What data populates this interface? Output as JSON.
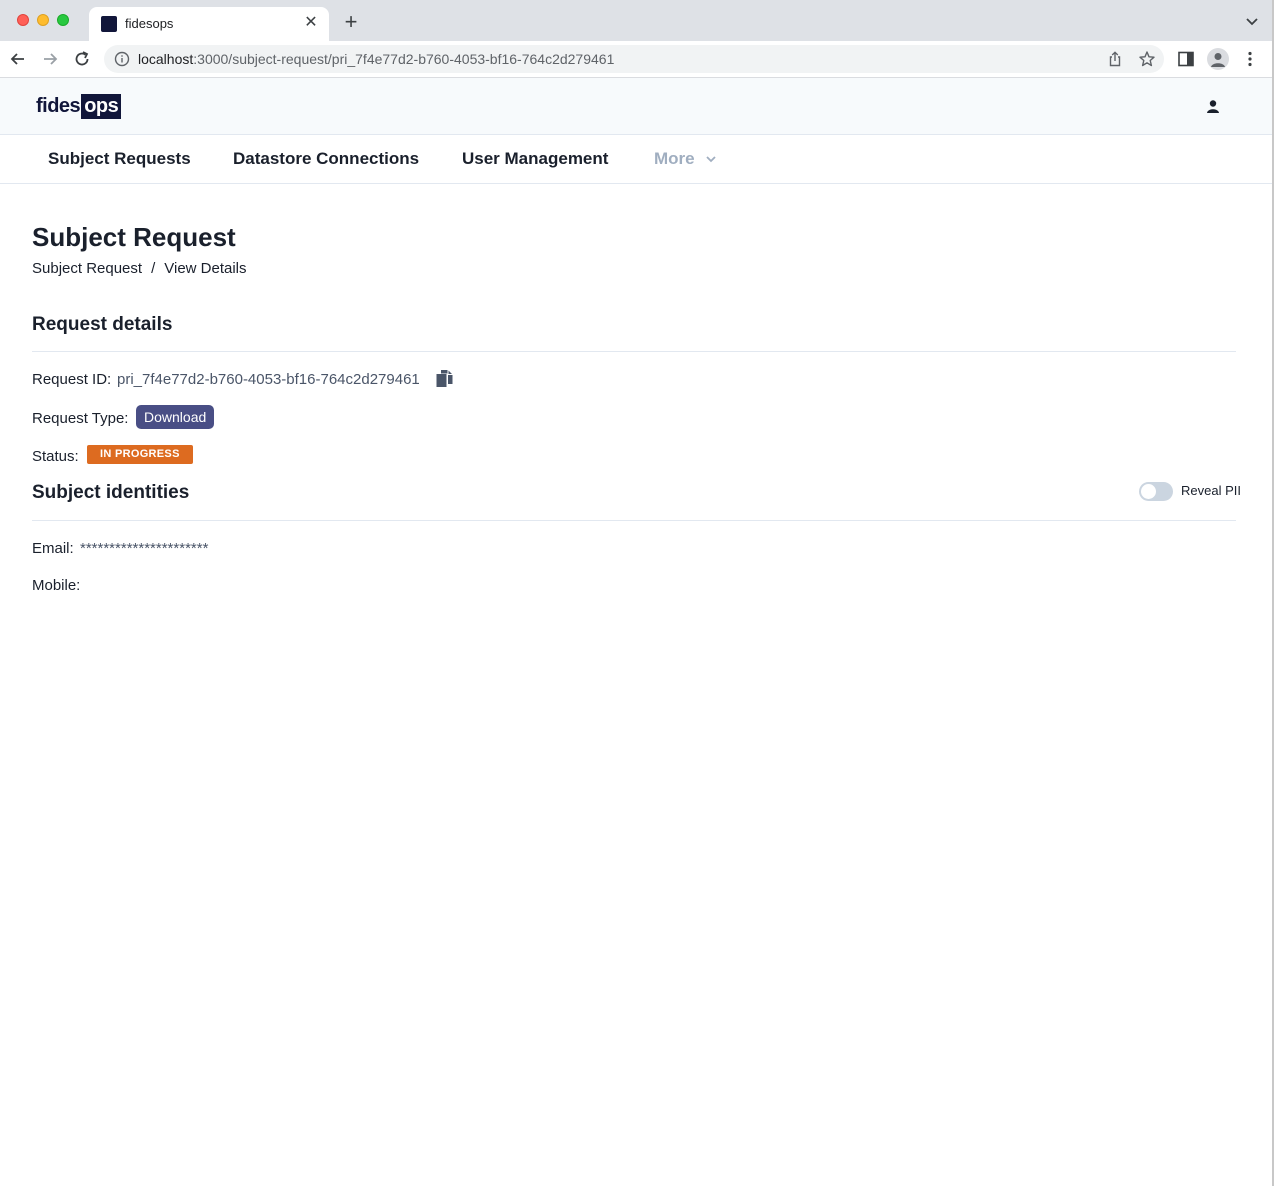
{
  "browser": {
    "tab_title": "fidesops",
    "tab_close": "✕",
    "new_tab": "+",
    "url_host": "localhost",
    "url_path": ":3000/subject-request/pri_7f4e77d2-b760-4053-bf16-764c2d279461"
  },
  "header": {
    "logo_primary": "fides",
    "logo_secondary": "ops"
  },
  "nav": {
    "items": [
      {
        "label": "Subject Requests"
      },
      {
        "label": "Datastore Connections"
      },
      {
        "label": "User Management"
      },
      {
        "label": "More"
      }
    ]
  },
  "page": {
    "title": "Subject Request",
    "breadcrumb": [
      "Subject Request",
      "/",
      "View Details"
    ]
  },
  "request_details": {
    "heading": "Request details",
    "request_id_label": "Request ID:",
    "request_id_value": "pri_7f4e77d2-b760-4053-bf16-764c2d279461",
    "request_type_label": "Request Type:",
    "request_type_value": "Download",
    "status_label": "Status:",
    "status_value": "IN PROGRESS"
  },
  "subject_identities": {
    "heading": "Subject identities",
    "reveal_label": "Reveal PII",
    "reveal_on": false,
    "email_label": "Email:",
    "email_value": "**********************",
    "mobile_label": "Mobile:",
    "mobile_value": ""
  },
  "colors": {
    "request_type_badge": "#494e85",
    "status_badge": "#dd6b20",
    "brand": "#11163a"
  }
}
